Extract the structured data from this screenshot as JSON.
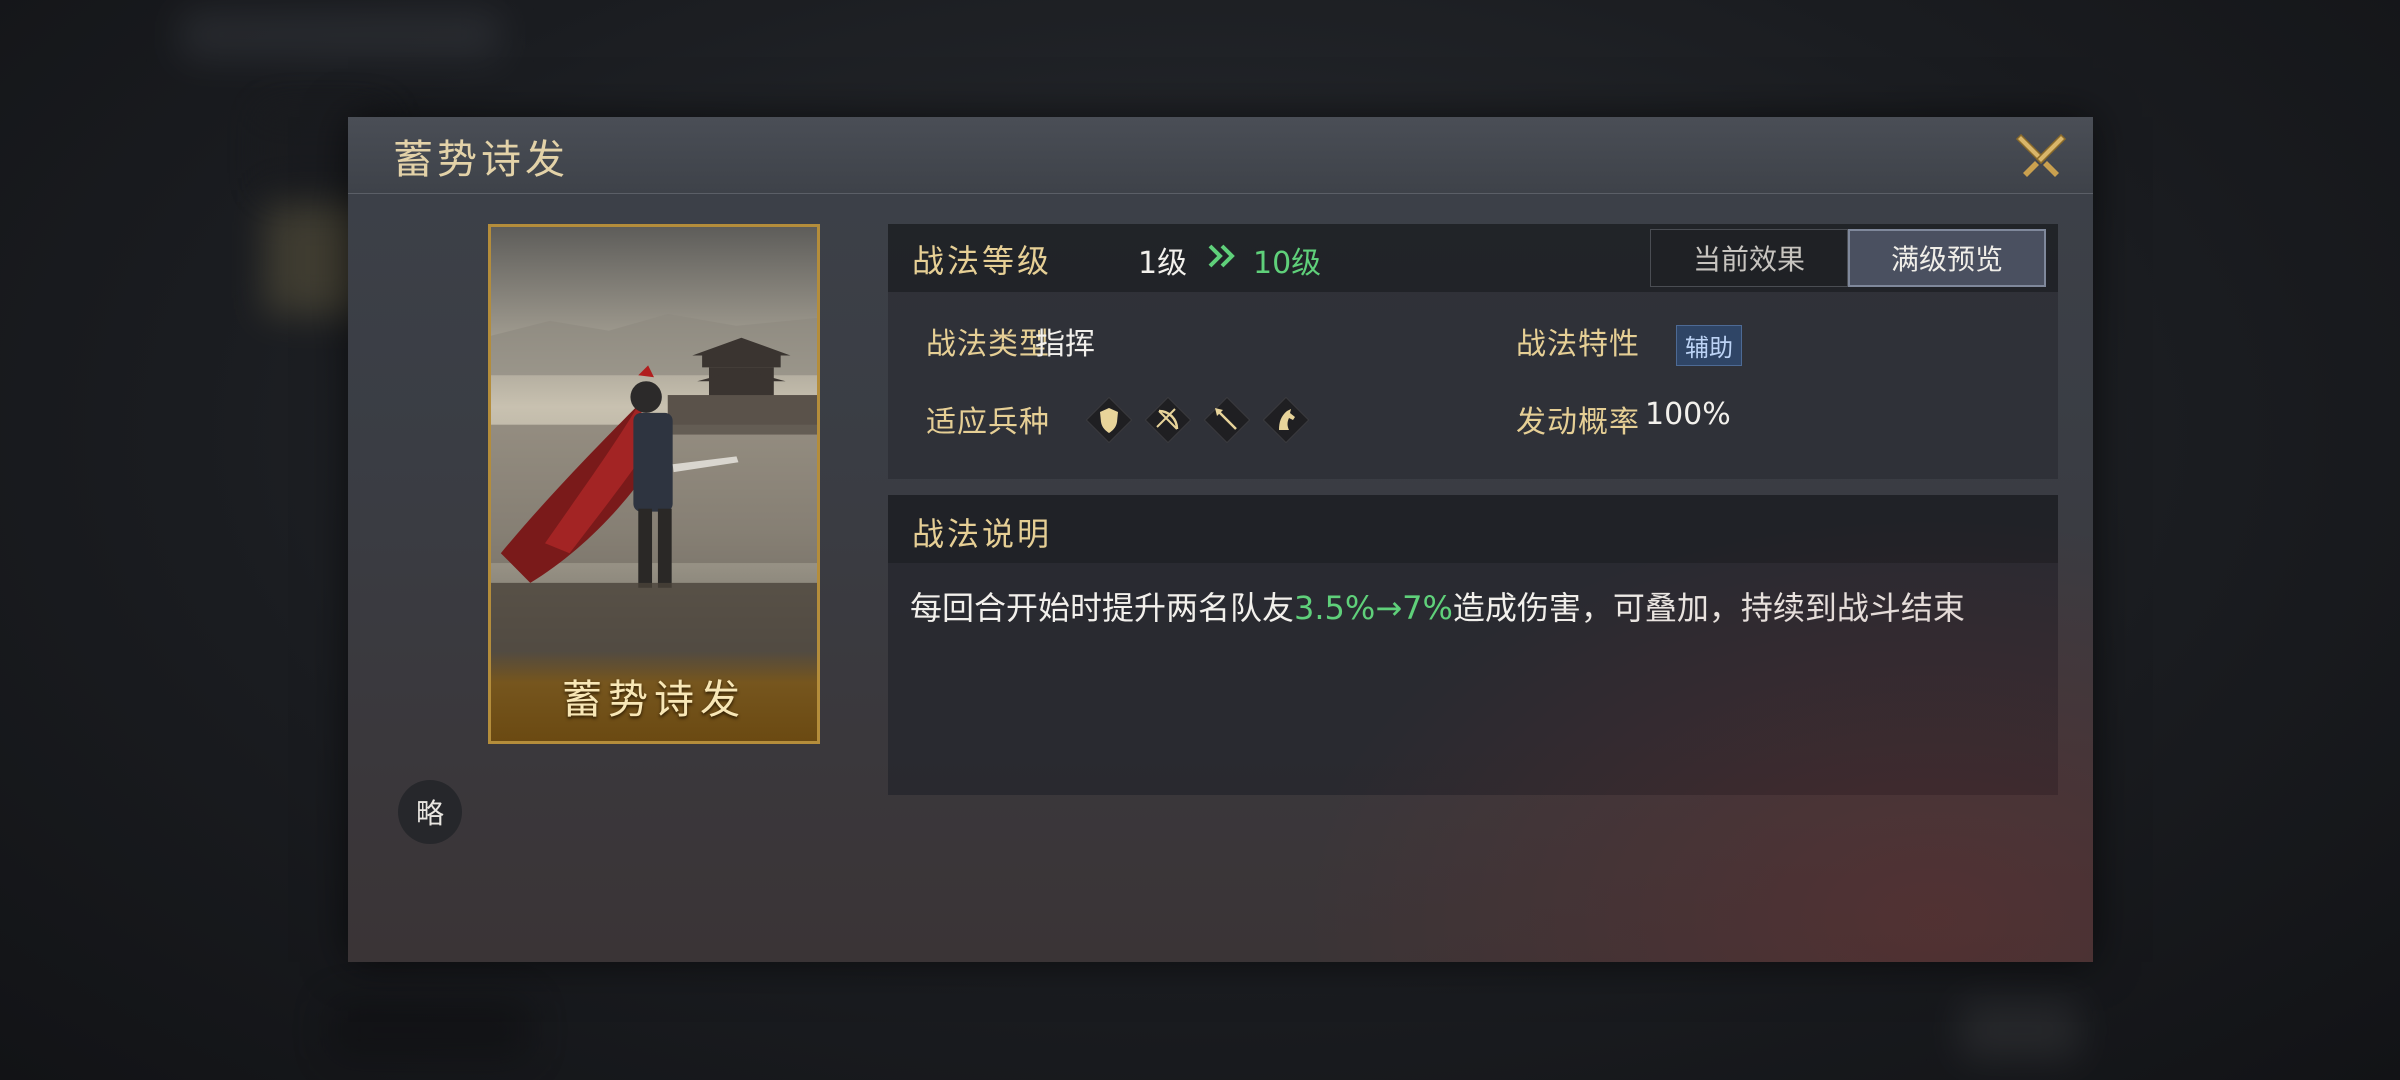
{
  "dialog": {
    "title": "蓄势诗发",
    "close_icon": "crossed-swords-close-icon"
  },
  "card": {
    "name": "蓄势诗发",
    "badge": "略",
    "art_icon": "general-on-battlefield-art"
  },
  "level": {
    "label": "战法等级",
    "from": "1级",
    "to": "10级",
    "arrow_icon": "double-chevron-right-icon",
    "to_color": "#5fd07a"
  },
  "tabs": [
    {
      "label": "当前效果",
      "selected": false
    },
    {
      "label": "满级预览",
      "selected": true
    }
  ],
  "attributes": {
    "type_label": "战法类型",
    "type_value": "指挥",
    "trait_label": "战法特性",
    "trait_value": "辅助",
    "troops_label": "适应兵种",
    "troops": [
      "shield-icon",
      "bow-icon",
      "spear-icon",
      "horse-icon"
    ],
    "rate_label": "发动概率",
    "rate_value": "100%"
  },
  "description": {
    "title": "战法说明",
    "text_before": "每回合开始时提升两名队友",
    "highlight": "3.5%→7%",
    "text_after": "造成伤害，可叠加，持续到战斗结束"
  },
  "colors": {
    "gold": "#e6cf95",
    "highlight_green": "#5fd07a",
    "card_border": "#b48d3b"
  }
}
